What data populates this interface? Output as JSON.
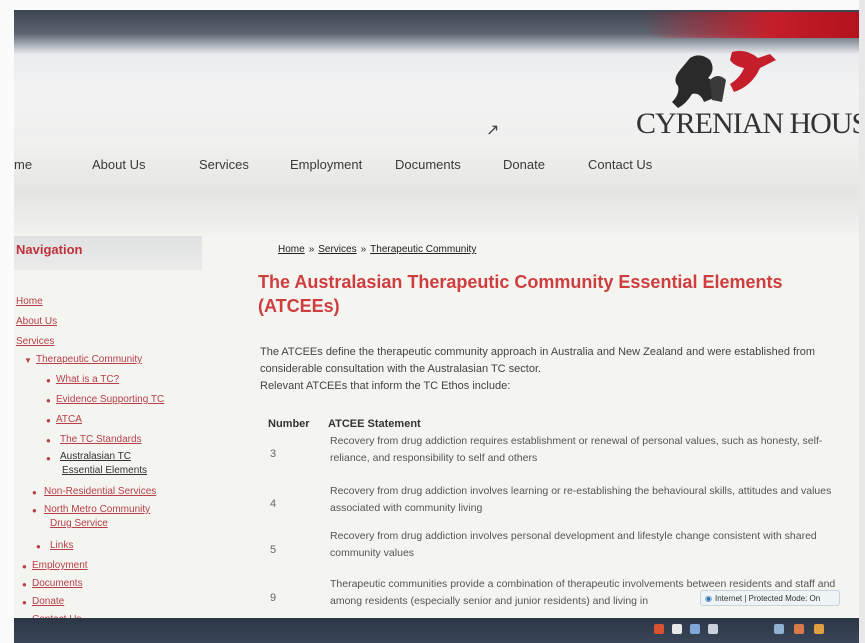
{
  "header": {
    "logo_text": "CYRENIAN HOUSE",
    "brand_red": "#c41e2a"
  },
  "nav": {
    "items": [
      {
        "label": "me"
      },
      {
        "label": "About Us"
      },
      {
        "label": "Services"
      },
      {
        "label": "Employment"
      },
      {
        "label": "Documents"
      },
      {
        "label": "Donate"
      },
      {
        "label": "Contact Us"
      }
    ]
  },
  "sidebar": {
    "title": "Navigation",
    "links": [
      "Home",
      "About Us",
      "Services",
      "Therapeutic Community",
      "What is a TC?",
      "Evidence Supporting TC",
      "ATCA",
      "The TC Standards",
      "Australasian TC",
      "Essential Elements",
      "Non-Residential Services",
      "North Metro Community",
      "Drug Service",
      "Links",
      "Employment",
      "Documents",
      "Donate",
      "Contact Us"
    ]
  },
  "breadcrumb": {
    "home": "Home",
    "services": "Services",
    "current": "Therapeutic Community",
    "separator": "»"
  },
  "page": {
    "title": "The Australasian Therapeutic Community Essential Elements (ATCEEs)",
    "intro_1": "The ATCEEs define the therapeutic community approach in Australia and New Zealand and were established from considerable consultation with the Australasian TC sector.",
    "intro_2": "Relevant ATCEEs that inform the TC Ethos include:"
  },
  "table": {
    "col_number": "Number",
    "col_statement": "ATCEE Statement",
    "rows": [
      {
        "number": "3",
        "statement": "Recovery from drug addiction requires establishment or renewal of personal values, such as honesty, self-reliance, and responsibility to self and others"
      },
      {
        "number": "4",
        "statement": "Recovery from drug addiction involves learning or re-establishing the behavioural skills, attitudes and values associated with community living"
      },
      {
        "number": "5",
        "statement": "Recovery from drug addiction involves personal development and lifestyle change consistent with shared community values"
      },
      {
        "number": "9",
        "statement": "Therapeutic communities provide a combination of therapeutic involvements between residents and staff and among residents (especially senior and junior residents) and living in"
      }
    ]
  },
  "status": {
    "zone": "Internet | Protected Mode: On"
  },
  "icons": [
    "cursor-icon",
    "globe-icon",
    "bullet-icon"
  ]
}
